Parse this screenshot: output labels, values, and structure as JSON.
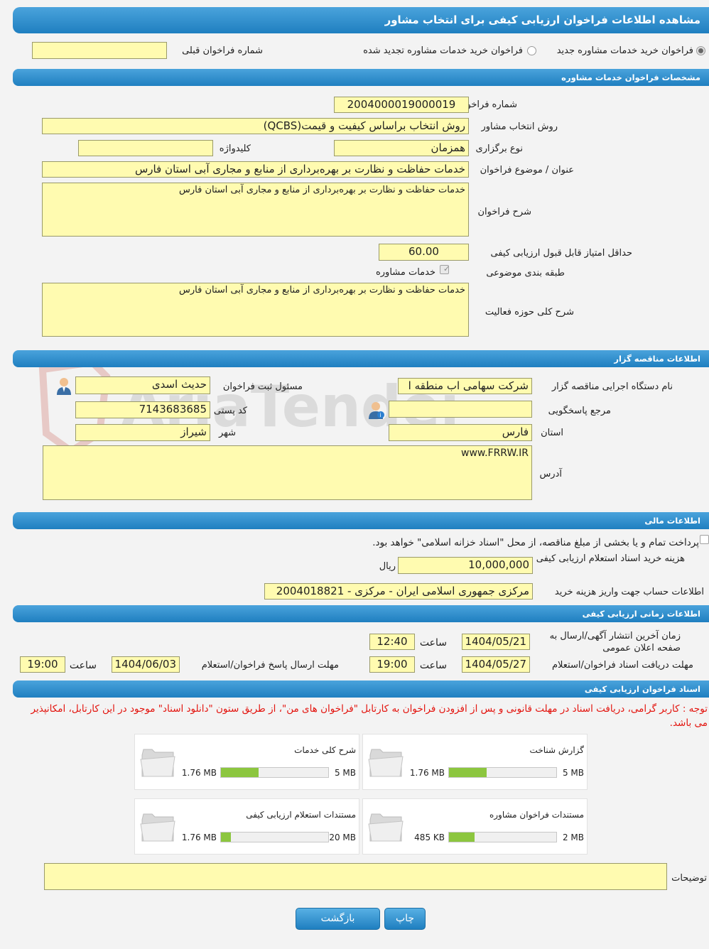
{
  "header": {
    "title": "مشاهده اطلاعات فراخوان ارزیابی کیفی برای انتخاب مشاور"
  },
  "top": {
    "radio_new": "فراخوان خرید خدمات مشاوره جدید",
    "radio_renewed": "فراخوان خرید خدمات مشاوره تجدید شده",
    "prev_label": "شماره فراخوان قبلی",
    "prev_value": ""
  },
  "sections": {
    "specs": "مشخصات فراخوان خدمات مشاوره",
    "tenderer": "اطلاعات مناقصه گزار",
    "finance": "اطلاعات مالی",
    "timing": "اطلاعات زمانی ارزیابی کیفی",
    "docs": "اسناد فراخوان ارزیابی کیفی"
  },
  "specs": {
    "number_label": "شماره فراخوان",
    "number": "2004000019000019",
    "method_label": "روش انتخاب مشاور",
    "method": "روش انتخاب براساس کیفیت و قیمت(QCBS)",
    "type_label": "نوع برگزاری",
    "type": "همزمان",
    "keyword_label": "کلیدواژه",
    "keyword": "",
    "subject_label": "عنوان / موضوع فراخوان",
    "subject": "خدمات حفاظت و نظارت بر بهره‌برداری از منابع و مجاری آبی استان فارس",
    "desc_label": "شرح فراخوان",
    "desc": "خدمات حفاظت و نظارت بر بهره‌برداری از منابع و مجاری آبی استان فارس",
    "min_score_label": "حداقل امتیاز قابل قبول ارزیابی کیفی",
    "min_score": "60.00",
    "category_label": "طبقه بندی موضوعی",
    "category": "خدمات مشاوره",
    "scope_label": "شرح کلی حوزه فعالیت",
    "scope": "خدمات حفاظت و نظارت بر بهره‌برداری از منابع و مجاری آبی استان فارس"
  },
  "tenderer": {
    "org_label": "نام دستگاه اجرایی مناقصه گزار",
    "org": "شرکت سهامی اب منطقه ا",
    "registrar_label": "مسئول ثبت فراخوان",
    "registrar": "حدیث  اسدی",
    "ref_label": "مرجع پاسخگویی",
    "ref": "",
    "postal_label": "کد پستی",
    "postal": "7143683685",
    "province_label": "استان",
    "province": "فارس",
    "city_label": "شهر",
    "city": "شیراز",
    "address_label": "آدرس",
    "address": "www.FRRW.IR"
  },
  "finance": {
    "treasury_text": "پرداخت تمام و یا بخشی از مبلغ مناقصه، از محل \"اسناد خزانه اسلامی\" خواهد بود.",
    "cost_label": "هزینه خرید اسناد استعلام ارزیابی کیفی",
    "cost": "10,000,000",
    "currency": "ریال",
    "account_label": "اطلاعات حساب جهت واریز هزینه خرید",
    "account": "مرکزی جمهوری اسلامی ایران - مرکزی - 2004018821"
  },
  "timing": {
    "publish_label": "زمان آخرین انتشار آگهی/ارسال به صفحه اعلان عمومی",
    "publish_date": "1404/05/21",
    "publish_time": "12:40",
    "time_label": "ساعت",
    "doc_deadline_label": "مهلت دریافت اسناد فراخوان/استعلام",
    "doc_deadline_date": "1404/05/27",
    "doc_deadline_time": "19:00",
    "reply_deadline_label": "مهلت ارسال پاسخ فراخوان/استعلام",
    "reply_deadline_date": "1404/06/03",
    "reply_deadline_time": "19:00"
  },
  "docs": {
    "notice": "توجه : کاربر گرامی، دریافت اسناد در مهلت قانونی و پس از افزودن فراخوان به کارتابل \"فراخوان های من\"، از طریق ستون \"دانلود اسناد\" موجود در این کارتابل، امکانپذیر می باشد.",
    "files": [
      {
        "title": "گزارش شناخت",
        "used": "1.76 MB",
        "total": "5 MB",
        "fraction": 0.35
      },
      {
        "title": "شرح کلی خدمات",
        "used": "1.76 MB",
        "total": "5 MB",
        "fraction": 0.35
      },
      {
        "title": "مستندات فراخوان مشاوره",
        "used": "485 KB",
        "total": "2 MB",
        "fraction": 0.24
      },
      {
        "title": "مستندات استعلام ارزیابی کیفی",
        "used": "1.76 MB",
        "total": "20 MB",
        "fraction": 0.09
      }
    ],
    "notes_label": "توضیحات",
    "notes": ""
  },
  "buttons": {
    "print": "چاپ",
    "back": "بازگشت"
  },
  "watermark": "AriaTender.neT",
  "colors": {
    "header": "#1f7fc0",
    "field": "#fffbb0",
    "notice": "#e3140e",
    "progress": "#8cc63f"
  }
}
